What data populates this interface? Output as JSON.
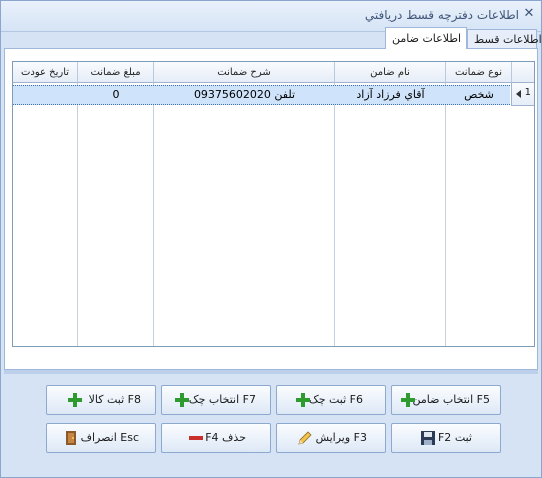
{
  "window": {
    "title": "اطلاعات دفترچه قسط دريافتي"
  },
  "tabs": [
    {
      "label": "اطلاعات قسط"
    },
    {
      "label": "اطلاعات ضامن"
    }
  ],
  "grid": {
    "columns": [
      "نوع ضمانت",
      "نام ضامن",
      "شرح ضمانت",
      "مبلغ ضمانت",
      "تاريخ عودت"
    ],
    "rows": [
      {
        "row_number": "1",
        "type": "شخص",
        "guarantor": "آقاي فرزاد  آزاد",
        "description": "تلفن 09375602020",
        "amount": "0",
        "return_date": ""
      }
    ]
  },
  "buttons": {
    "select_guarantor": "انتخاب ضامن F5",
    "register_check": "ثبت چک F6",
    "select_check": "انتخاب چک F7",
    "register_goods": "ثبت کالا F8",
    "save": "F2 ثبت",
    "edit": "ويرايش F3",
    "delete": "F4 حذف",
    "cancel": "انصراف Esc"
  },
  "colors": {
    "add": "#2e9b2e",
    "delete": "#c9302c",
    "selected_row": "#cfe3fa"
  }
}
